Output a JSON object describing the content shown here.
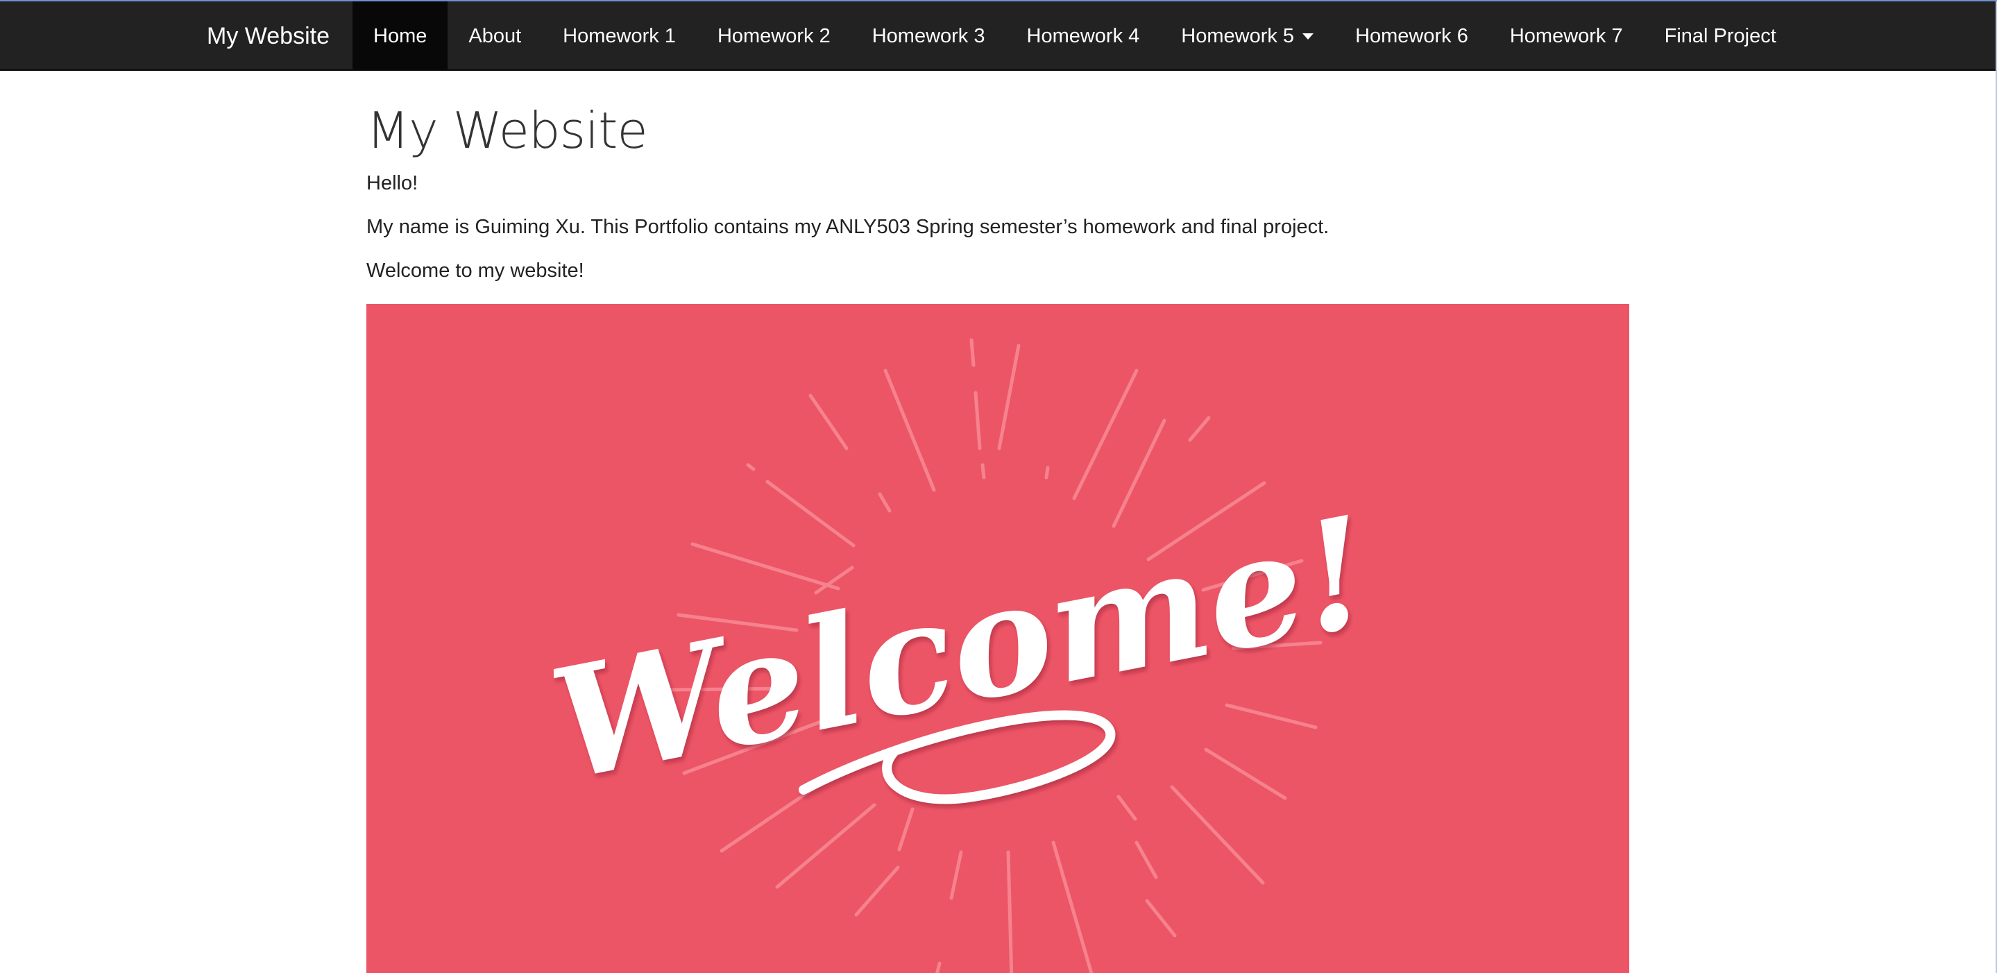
{
  "navbar": {
    "brand": "My Website",
    "items": [
      {
        "label": "Home",
        "active": true
      },
      {
        "label": "About",
        "active": false
      },
      {
        "label": "Homework 1",
        "active": false
      },
      {
        "label": "Homework 2",
        "active": false
      },
      {
        "label": "Homework 3",
        "active": false
      },
      {
        "label": "Homework 4",
        "active": false
      },
      {
        "label": "Homework 5",
        "active": false,
        "dropdown": true
      },
      {
        "label": "Homework 6",
        "active": false
      },
      {
        "label": "Homework 7",
        "active": false
      },
      {
        "label": "Final Project",
        "active": false
      }
    ],
    "background": "#222222",
    "active_background": "#080808"
  },
  "main": {
    "title": "My Website",
    "paragraphs": [
      "Hello!",
      "My name is Guiming Xu. This Portfolio contains my ANLY503 Spring semester’s homework and final project.",
      "Welcome to my website!"
    ]
  },
  "banner": {
    "text": "Welcome!",
    "background": "#ec5566",
    "text_color": "#ffffff"
  }
}
